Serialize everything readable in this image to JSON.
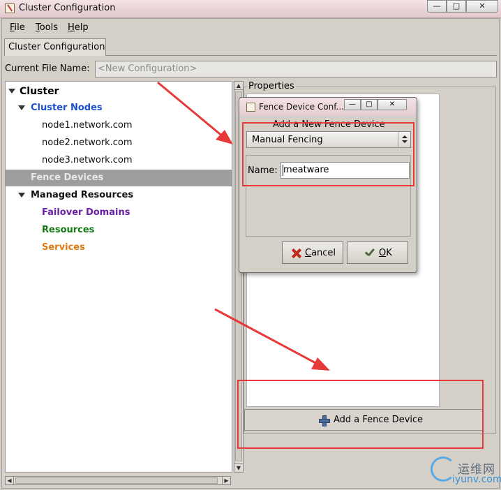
{
  "window": {
    "title": "Cluster Configuration",
    "controls": {
      "minimize": "—",
      "maximize": "□",
      "close": "✕"
    }
  },
  "menubar": {
    "file": {
      "mnemonic": "F",
      "rest": "ile"
    },
    "tools": {
      "mnemonic": "T",
      "rest": "ools"
    },
    "help": {
      "mnemonic": "H",
      "rest": "elp"
    }
  },
  "tab": {
    "label": "Cluster Configuration"
  },
  "current_file": {
    "label": "Current File Name:",
    "value": "<New Configuration>"
  },
  "tree": {
    "cluster": "Cluster",
    "cluster_nodes": "Cluster Nodes",
    "nodes": [
      "node1.network.com",
      "node2.network.com",
      "node3.network.com"
    ],
    "fence_devices": "Fence Devices",
    "managed_resources": "Managed Resources",
    "failover_domains": "Failover Domains",
    "resources": "Resources",
    "services": "Services",
    "selected": "Fence Devices"
  },
  "properties": {
    "label": "Properties",
    "add_button": "Add a Fence Device"
  },
  "dialog": {
    "title": "Fence Device Conf...",
    "heading": "Add a New Fence Device",
    "device_type": "Manual Fencing",
    "name_label": "Name:",
    "name_value": "meatware",
    "cancel": {
      "mnemonic": "C",
      "rest": "ancel"
    },
    "ok": {
      "mnemonic": "O",
      "rest": "K"
    }
  },
  "colors": {
    "annotation_red": "#e8393a",
    "cluster_nodes_blue": "#1c4fcc",
    "failover_purple": "#6a21a8",
    "resources_green": "#147a14",
    "services_orange": "#e07a12",
    "selected_row_gray": "#9e9e9e"
  },
  "watermark": {
    "cn": "运维网",
    "en": "iyunv.com"
  }
}
